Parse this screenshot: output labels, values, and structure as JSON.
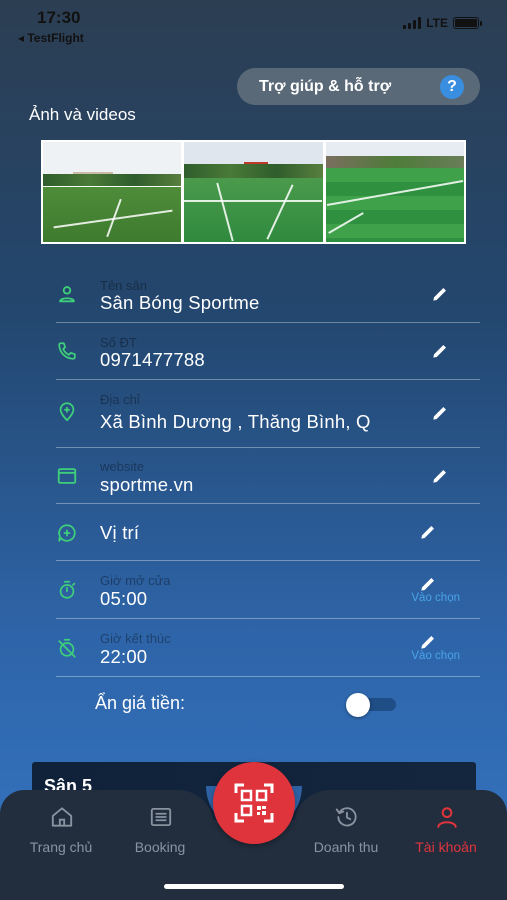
{
  "status_bar": {
    "time": "17:30",
    "back_app": "◂ TestFlight",
    "network": "LTE"
  },
  "help_button": {
    "label": "Trợ giúp & hỗ trợ",
    "icon": "?"
  },
  "media": {
    "title": "Ảnh và videos",
    "photos": [
      "football-field-photo-1",
      "football-field-photo-2",
      "football-field-photo-3"
    ]
  },
  "fields": {
    "name": {
      "label": "Tên sân",
      "value": "Sân Bóng Sportme"
    },
    "phone": {
      "label": "Số ĐT",
      "value": "0971477788"
    },
    "address": {
      "label": "Địa chỉ",
      "value": "Xã Bình Dương , Thăng Bình, Q"
    },
    "website": {
      "label": "website",
      "value": "sportme.vn"
    },
    "location": {
      "value": "Vị trí"
    },
    "open_time": {
      "label": "Giờ mở cửa",
      "value": "05:00",
      "choose": "Vào chọn"
    },
    "close_time": {
      "label": "Giờ kết thúc",
      "value": "22:00",
      "choose": "Vào chọn"
    }
  },
  "hide_price": {
    "label": "Ẩn giá tiền:",
    "enabled": false
  },
  "court_card": {
    "title": "Sân 5"
  },
  "bottom_nav": {
    "items": [
      {
        "label": "Trang chủ",
        "icon": "home-icon"
      },
      {
        "label": "Booking",
        "icon": "list-icon"
      },
      {
        "label": "Doanh thu",
        "icon": "history-icon"
      },
      {
        "label": "Tài khoản",
        "icon": "account-icon",
        "active": true
      }
    ],
    "center_icon": "qr-scan-icon"
  },
  "colors": {
    "accent_green": "#3ecf7a",
    "accent_red": "#e0343d",
    "link_blue": "#4aa3e8"
  }
}
